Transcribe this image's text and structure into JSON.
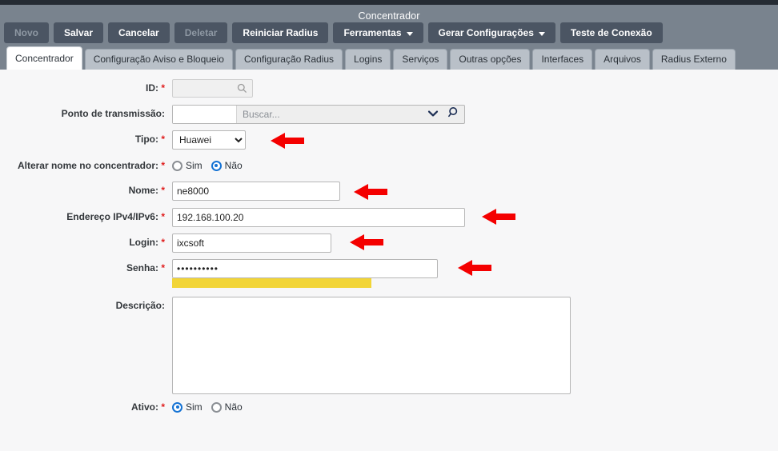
{
  "window": {
    "title": "Concentrador"
  },
  "toolbar": {
    "buttons": [
      {
        "label": "Novo",
        "disabled": true,
        "caret": false
      },
      {
        "label": "Salvar",
        "disabled": false,
        "caret": false
      },
      {
        "label": "Cancelar",
        "disabled": false,
        "caret": false
      },
      {
        "label": "Deletar",
        "disabled": true,
        "caret": false
      },
      {
        "label": "Reiniciar Radius",
        "disabled": false,
        "caret": false
      },
      {
        "label": "Ferramentas",
        "disabled": false,
        "caret": true
      },
      {
        "label": "Gerar Configurações",
        "disabled": false,
        "caret": true
      },
      {
        "label": "Teste de Conexão",
        "disabled": false,
        "caret": false
      }
    ]
  },
  "tabs": [
    {
      "label": "Concentrador",
      "active": true
    },
    {
      "label": "Configuração Aviso e Bloqueio",
      "active": false
    },
    {
      "label": "Configuração Radius",
      "active": false
    },
    {
      "label": "Logins",
      "active": false
    },
    {
      "label": "Serviços",
      "active": false
    },
    {
      "label": "Outras opções",
      "active": false
    },
    {
      "label": "Interfaces",
      "active": false
    },
    {
      "label": "Arquivos",
      "active": false
    },
    {
      "label": "Radius Externo",
      "active": false
    }
  ],
  "form": {
    "id": {
      "label": "ID:",
      "required": true,
      "value": "",
      "icon": "search-icon"
    },
    "ponto_transmissao": {
      "label": "Ponto de transmissão:",
      "required": false,
      "code_value": "",
      "placeholder": "Buscar..."
    },
    "tipo": {
      "label": "Tipo:",
      "required": true,
      "value": "Huawei",
      "options": [
        "Huawei"
      ]
    },
    "alterar_nome": {
      "label": "Alterar nome no concentrador:",
      "required": true,
      "options": [
        "Sim",
        "Não"
      ],
      "selected": "Não"
    },
    "nome": {
      "label": "Nome:",
      "required": true,
      "value": "ne8000"
    },
    "endereco": {
      "label": "Endereço IPv4/IPv6:",
      "required": true,
      "value": "192.168.100.20"
    },
    "login": {
      "label": "Login:",
      "required": true,
      "value": "ixcsoft"
    },
    "senha": {
      "label": "Senha:",
      "required": true,
      "value": "••••••••••",
      "strength_color": "#f2d537"
    },
    "descricao": {
      "label": "Descrição:",
      "required": false,
      "value": ""
    },
    "ativo": {
      "label": "Ativo:",
      "required": true,
      "options": [
        "Sim",
        "Não"
      ],
      "selected": "Sim"
    }
  },
  "annotations": {
    "arrow_color": "#f40000",
    "count": 5
  },
  "colors": {
    "toolbar_bg": "#79838e",
    "button_bg": "#4b5563",
    "tab_bg": "#b9c0c8",
    "tab_active_bg": "#ffffff",
    "panel_bg": "#f7f7f8",
    "required_star": "#e01b1b",
    "radio_on": "#1573d4"
  }
}
